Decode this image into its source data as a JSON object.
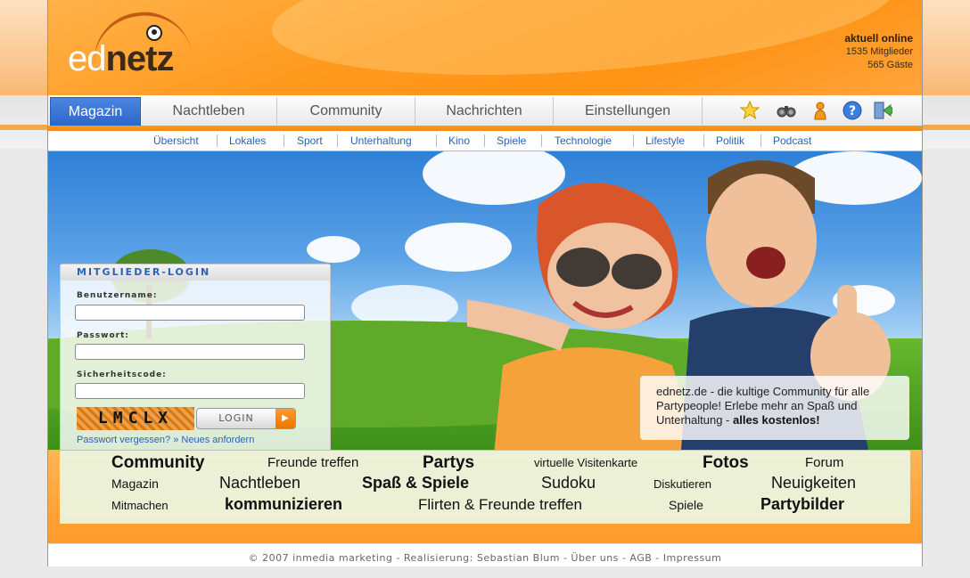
{
  "logo": {
    "ed": "ed",
    "netz": "netz"
  },
  "online": {
    "title": "aktuell online",
    "members": "1535 Mitglieder",
    "guests": "565 Gäste"
  },
  "main_nav": [
    "Magazin",
    "Nachtleben",
    "Community",
    "Nachrichten",
    "Einstellungen"
  ],
  "nav_icons": [
    "star-icon",
    "binoculars-icon",
    "user-icon",
    "help-icon",
    "logout-icon"
  ],
  "sub_nav": [
    "Übersicht",
    "Lokales",
    "Sport",
    "Unterhaltung",
    "Kino",
    "Spiele",
    "Technologie",
    "Lifestyle",
    "Politik",
    "Podcast"
  ],
  "login": {
    "title": "MITGLIEDER-LOGIN",
    "username_label": "Benutzername:",
    "password_label": "Passwort:",
    "captcha_label": "Sicherheitscode:",
    "captcha_text": "LMCLX",
    "button": "LOGIN",
    "forgot": "Passwort vergessen? » Neues anfordern"
  },
  "promo": {
    "text": "ednetz.de - die kultige Community für alle Partypeople! Erlebe mehr an Spaß und Unterhaltung - ",
    "bold": "alles kostenlos!"
  },
  "tags": [
    "Community",
    "Freunde treffen",
    "Partys",
    "virtuelle Visitenkarte",
    "Fotos",
    "Forum",
    "Magazin",
    "Nachtleben",
    "Spaß & Spiele",
    "Sudoku",
    "Diskutieren",
    "Neuigkeiten",
    "Mitmachen",
    "kommunizieren",
    "Flirten & Freunde treffen",
    "Spiele",
    "Partybilder"
  ],
  "footer": "© 2007 inmedia marketing - Realisierung: Sebastian Blum - Über uns - AGB - Impressum",
  "colors": {
    "accent": "#ff9a1f",
    "link": "#2c62b6",
    "active_tab": "#3a76d6"
  }
}
